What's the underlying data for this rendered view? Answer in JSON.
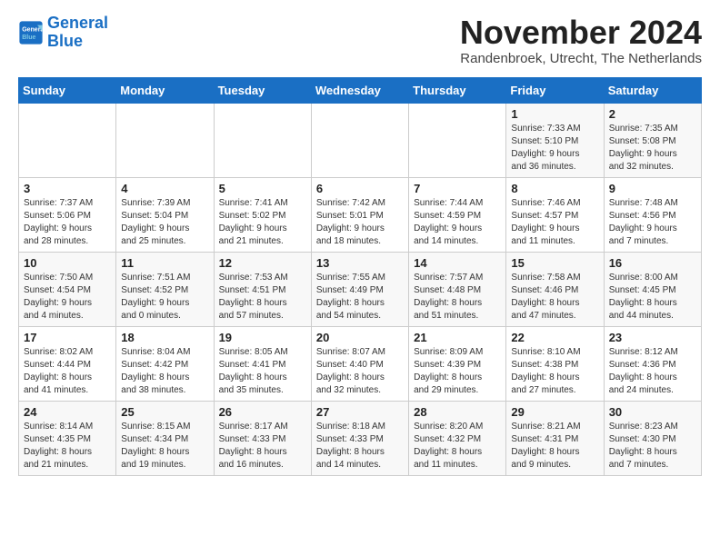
{
  "header": {
    "logo_line1": "General",
    "logo_line2": "Blue",
    "month": "November 2024",
    "location": "Randenbroek, Utrecht, The Netherlands"
  },
  "weekdays": [
    "Sunday",
    "Monday",
    "Tuesday",
    "Wednesday",
    "Thursday",
    "Friday",
    "Saturday"
  ],
  "weeks": [
    [
      {
        "day": "",
        "info": ""
      },
      {
        "day": "",
        "info": ""
      },
      {
        "day": "",
        "info": ""
      },
      {
        "day": "",
        "info": ""
      },
      {
        "day": "",
        "info": ""
      },
      {
        "day": "1",
        "info": "Sunrise: 7:33 AM\nSunset: 5:10 PM\nDaylight: 9 hours\nand 36 minutes."
      },
      {
        "day": "2",
        "info": "Sunrise: 7:35 AM\nSunset: 5:08 PM\nDaylight: 9 hours\nand 32 minutes."
      }
    ],
    [
      {
        "day": "3",
        "info": "Sunrise: 7:37 AM\nSunset: 5:06 PM\nDaylight: 9 hours\nand 28 minutes."
      },
      {
        "day": "4",
        "info": "Sunrise: 7:39 AM\nSunset: 5:04 PM\nDaylight: 9 hours\nand 25 minutes."
      },
      {
        "day": "5",
        "info": "Sunrise: 7:41 AM\nSunset: 5:02 PM\nDaylight: 9 hours\nand 21 minutes."
      },
      {
        "day": "6",
        "info": "Sunrise: 7:42 AM\nSunset: 5:01 PM\nDaylight: 9 hours\nand 18 minutes."
      },
      {
        "day": "7",
        "info": "Sunrise: 7:44 AM\nSunset: 4:59 PM\nDaylight: 9 hours\nand 14 minutes."
      },
      {
        "day": "8",
        "info": "Sunrise: 7:46 AM\nSunset: 4:57 PM\nDaylight: 9 hours\nand 11 minutes."
      },
      {
        "day": "9",
        "info": "Sunrise: 7:48 AM\nSunset: 4:56 PM\nDaylight: 9 hours\nand 7 minutes."
      }
    ],
    [
      {
        "day": "10",
        "info": "Sunrise: 7:50 AM\nSunset: 4:54 PM\nDaylight: 9 hours\nand 4 minutes."
      },
      {
        "day": "11",
        "info": "Sunrise: 7:51 AM\nSunset: 4:52 PM\nDaylight: 9 hours\nand 0 minutes."
      },
      {
        "day": "12",
        "info": "Sunrise: 7:53 AM\nSunset: 4:51 PM\nDaylight: 8 hours\nand 57 minutes."
      },
      {
        "day": "13",
        "info": "Sunrise: 7:55 AM\nSunset: 4:49 PM\nDaylight: 8 hours\nand 54 minutes."
      },
      {
        "day": "14",
        "info": "Sunrise: 7:57 AM\nSunset: 4:48 PM\nDaylight: 8 hours\nand 51 minutes."
      },
      {
        "day": "15",
        "info": "Sunrise: 7:58 AM\nSunset: 4:46 PM\nDaylight: 8 hours\nand 47 minutes."
      },
      {
        "day": "16",
        "info": "Sunrise: 8:00 AM\nSunset: 4:45 PM\nDaylight: 8 hours\nand 44 minutes."
      }
    ],
    [
      {
        "day": "17",
        "info": "Sunrise: 8:02 AM\nSunset: 4:44 PM\nDaylight: 8 hours\nand 41 minutes."
      },
      {
        "day": "18",
        "info": "Sunrise: 8:04 AM\nSunset: 4:42 PM\nDaylight: 8 hours\nand 38 minutes."
      },
      {
        "day": "19",
        "info": "Sunrise: 8:05 AM\nSunset: 4:41 PM\nDaylight: 8 hours\nand 35 minutes."
      },
      {
        "day": "20",
        "info": "Sunrise: 8:07 AM\nSunset: 4:40 PM\nDaylight: 8 hours\nand 32 minutes."
      },
      {
        "day": "21",
        "info": "Sunrise: 8:09 AM\nSunset: 4:39 PM\nDaylight: 8 hours\nand 29 minutes."
      },
      {
        "day": "22",
        "info": "Sunrise: 8:10 AM\nSunset: 4:38 PM\nDaylight: 8 hours\nand 27 minutes."
      },
      {
        "day": "23",
        "info": "Sunrise: 8:12 AM\nSunset: 4:36 PM\nDaylight: 8 hours\nand 24 minutes."
      }
    ],
    [
      {
        "day": "24",
        "info": "Sunrise: 8:14 AM\nSunset: 4:35 PM\nDaylight: 8 hours\nand 21 minutes."
      },
      {
        "day": "25",
        "info": "Sunrise: 8:15 AM\nSunset: 4:34 PM\nDaylight: 8 hours\nand 19 minutes."
      },
      {
        "day": "26",
        "info": "Sunrise: 8:17 AM\nSunset: 4:33 PM\nDaylight: 8 hours\nand 16 minutes."
      },
      {
        "day": "27",
        "info": "Sunrise: 8:18 AM\nSunset: 4:33 PM\nDaylight: 8 hours\nand 14 minutes."
      },
      {
        "day": "28",
        "info": "Sunrise: 8:20 AM\nSunset: 4:32 PM\nDaylight: 8 hours\nand 11 minutes."
      },
      {
        "day": "29",
        "info": "Sunrise: 8:21 AM\nSunset: 4:31 PM\nDaylight: 8 hours\nand 9 minutes."
      },
      {
        "day": "30",
        "info": "Sunrise: 8:23 AM\nSunset: 4:30 PM\nDaylight: 8 hours\nand 7 minutes."
      }
    ]
  ]
}
